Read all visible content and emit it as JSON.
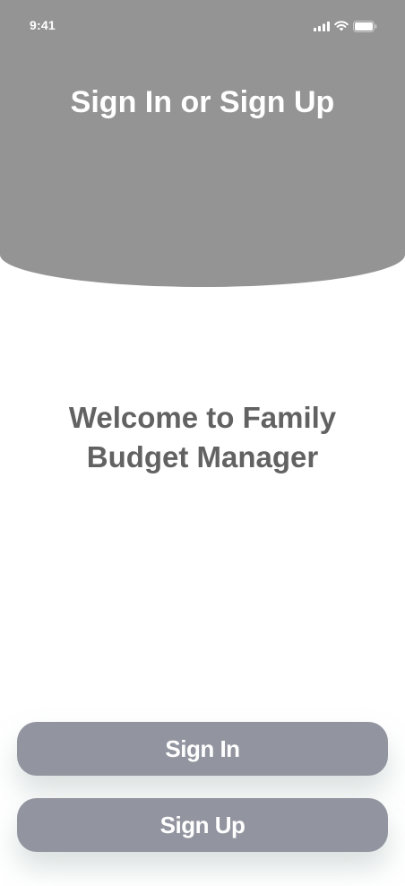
{
  "status_bar": {
    "time": "9:41",
    "icons": [
      "cellular-signal-icon",
      "wifi-icon",
      "battery-icon"
    ]
  },
  "header": {
    "title": "Sign In or Sign Up"
  },
  "main": {
    "welcome_text": "Welcome to Family Budget Manager"
  },
  "actions": {
    "sign_in_label": "Sign In",
    "sign_up_label": "Sign Up"
  },
  "colors": {
    "header_bg": "#949494",
    "button_bg": "#92959f",
    "welcome_text": "#626262",
    "background": "#ffffff"
  }
}
